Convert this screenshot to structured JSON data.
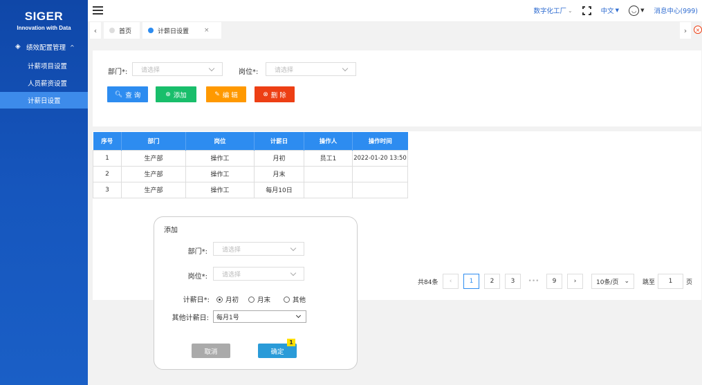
{
  "brand": {
    "name": "SIGER",
    "tagline": "Innovation with Data"
  },
  "sidebar": {
    "group_label": "绩效配置管理",
    "items": [
      {
        "label": "计薪项目设置",
        "active": false
      },
      {
        "label": "人员薪资设置",
        "active": false
      },
      {
        "label": "计薪日设置",
        "active": true
      }
    ]
  },
  "topbar": {
    "factory": "数字化工厂",
    "language": "中文",
    "messages": "消息中心(999)"
  },
  "tabs": [
    {
      "label": "首页",
      "active": false
    },
    {
      "label": "计薪日设置",
      "active": true
    }
  ],
  "filter": {
    "dept_label": "部门*:",
    "dept_placeholder": "请选择",
    "post_label": "岗位*:",
    "post_placeholder": "请选择",
    "buttons": {
      "search": "查 询",
      "add": "添加",
      "edit": "编 辑",
      "delete": "删 除"
    }
  },
  "table": {
    "headers": [
      "序号",
      "部门",
      "岗位",
      "计薪日",
      "操作人",
      "操作时间"
    ],
    "rows": [
      [
        "1",
        "生产部",
        "操作工",
        "月初",
        "员工1",
        "2022-01-20 13:50"
      ],
      [
        "2",
        "生产部",
        "操作工",
        "月末",
        "",
        ""
      ],
      [
        "3",
        "生产部",
        "操作工",
        "每月10日",
        "",
        ""
      ]
    ]
  },
  "pagination": {
    "total": "共84条",
    "pages": [
      "1",
      "2",
      "3",
      "•••",
      "9"
    ],
    "current": "1",
    "page_size": "10条/页",
    "jump_label": "跳至",
    "jump_value": "1",
    "page_suffix": "页"
  },
  "dialog": {
    "title": "添加",
    "dept_label": "部门*:",
    "dept_placeholder": "请选择",
    "post_label": "岗位*:",
    "post_placeholder": "请选择",
    "payday_label": "计薪日*:",
    "payday_options": [
      "月初",
      "月末",
      "其他"
    ],
    "payday_selected": "月初",
    "other_label": "其他计薪日:",
    "other_value": "每月1号",
    "cancel": "取消",
    "confirm": "确定",
    "badge": "1"
  },
  "colors": {
    "sidebar": "#1656bd",
    "primary": "#2d8cf0",
    "search_btn": "#2d8cf0",
    "add_btn": "#19be6b",
    "edit_btn": "#ff9900",
    "delete_btn": "#ed3f14"
  }
}
